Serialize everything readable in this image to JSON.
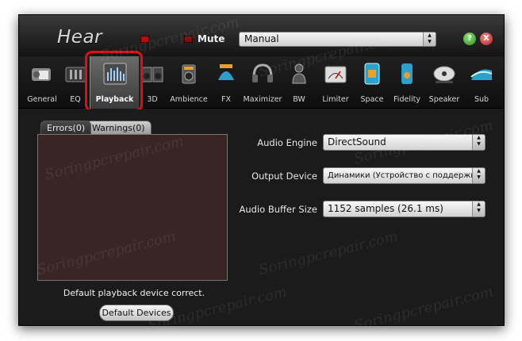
{
  "app": {
    "logo_text": "Hear",
    "mute_label": "Mute",
    "preset_value": "Manual",
    "help_label": "?",
    "close_label": "X"
  },
  "tabs": [
    {
      "label": "General",
      "icon": "general-icon"
    },
    {
      "label": "EQ",
      "icon": "eq-icon"
    },
    {
      "label": "Playback",
      "icon": "playback-icon",
      "active": true
    },
    {
      "label": "3D",
      "icon": "3d-speakers-icon"
    },
    {
      "label": "Ambience",
      "icon": "ambience-icon"
    },
    {
      "label": "FX",
      "icon": "fx-icon"
    },
    {
      "label": "Maximizer",
      "icon": "headphones-icon"
    },
    {
      "label": "BW",
      "icon": "bw-icon"
    },
    {
      "label": "Limiter",
      "icon": "limiter-meter-icon"
    },
    {
      "label": "Space",
      "icon": "space-icon"
    },
    {
      "label": "Fidelity",
      "icon": "fidelity-icon"
    },
    {
      "label": "Speaker",
      "icon": "speaker-icon"
    },
    {
      "label": "Sub",
      "icon": "sub-icon"
    }
  ],
  "log": {
    "errors_tab": "Errors(0)",
    "warnings_tab": "Warnings(0)"
  },
  "status": {
    "message": "Default playback device correct.",
    "default_devices_button": "Default Devices"
  },
  "settings": {
    "audio_engine_label": "Audio Engine",
    "audio_engine_value": "DirectSound",
    "output_device_label": "Output Device",
    "output_device_value": "Динамики (Устройство с поддержко...",
    "buffer_size_label": "Audio Buffer Size",
    "buffer_size_value": "1152 samples (26.1 ms)"
  },
  "watermark": "Soringpcrepair.com",
  "colors": {
    "highlight": "#e01010",
    "window_bg": "#1b1b1b"
  }
}
